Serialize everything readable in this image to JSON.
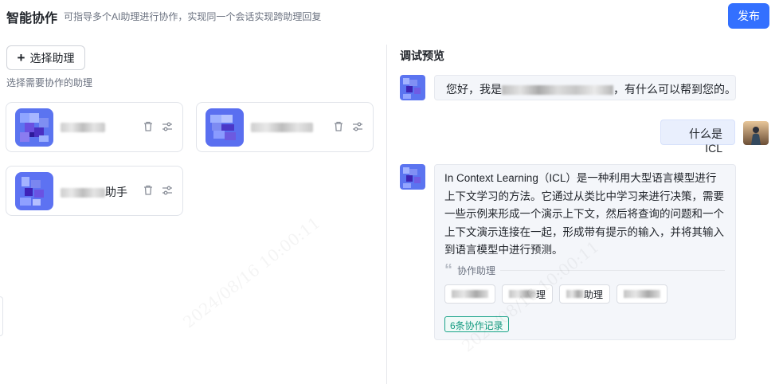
{
  "header": {
    "title": "智能协作",
    "subtitle": "可指导多个AI助理进行协作，实现同一个会话实现跨助理回复",
    "publish_label": "发布"
  },
  "left_panel": {
    "select_button_label": "选择助理",
    "hint": "选择需要协作的助理",
    "assistants": [
      {
        "name_suffix": ""
      },
      {
        "name_suffix": ""
      },
      {
        "name_suffix": "助手"
      }
    ]
  },
  "preview": {
    "title": "调试预览",
    "greeting_prefix": "您好，我是",
    "greeting_suffix": "，有什么可以帮到您的。",
    "user_message": "什么是ICL",
    "answer": "In Context Learning（ICL）是一种利用大型语言模型进行上下文学习的方法。它通过从类比中学习来进行决策，需要一些示例来形成一个演示上下文，然后将查询的问题和一个上下文演示连接在一起，形成带有提示的输入，并将其输入到语言模型中进行预测。",
    "collab_label": "协作助理",
    "chips": [
      {
        "suffix": ""
      },
      {
        "suffix": "理"
      },
      {
        "suffix": "助理"
      },
      {
        "suffix": ""
      }
    ],
    "record_tag": "6条协作记录"
  },
  "icons": [
    "plus-icon",
    "trash-icon",
    "sliders-icon",
    "quote-icon"
  ],
  "colors": {
    "accent": "#3370ff",
    "record_green": "#1aa389",
    "user_bubble": "#e9effd",
    "bot_bubble": "#f4f6fa"
  }
}
